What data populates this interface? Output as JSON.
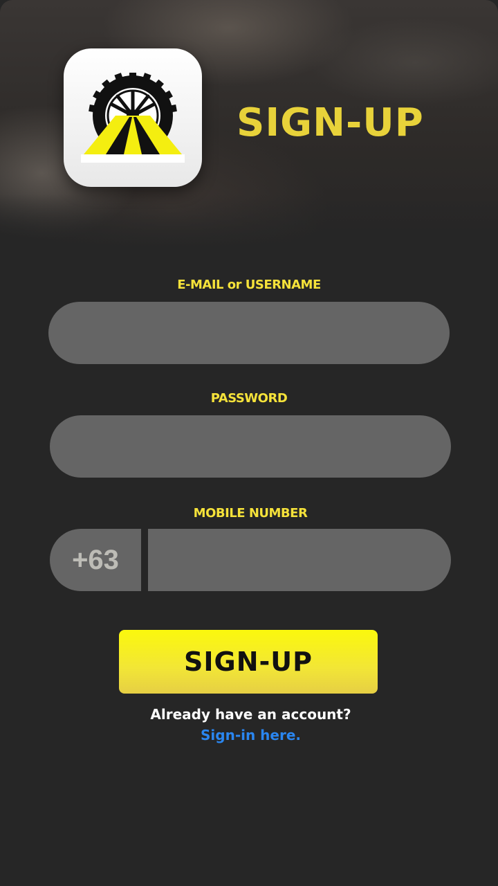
{
  "header": {
    "title": "SIGN-UP",
    "logo_icon": "tire-road-logo-icon"
  },
  "form": {
    "email_label": "E-MAIL or USERNAME",
    "email_value": "",
    "password_label": "PASSWORD",
    "password_value": "",
    "mobile_label": "MOBILE NUMBER",
    "country_code": "+63",
    "mobile_value": ""
  },
  "actions": {
    "signup_label": "SIGN-UP",
    "already_text": "Already have an account?",
    "signin_link": "Sign-in here."
  },
  "colors": {
    "background": "#262626",
    "accent_yellow": "#f5e23a",
    "field_bg": "#656565",
    "link_blue": "#2a86f0"
  }
}
